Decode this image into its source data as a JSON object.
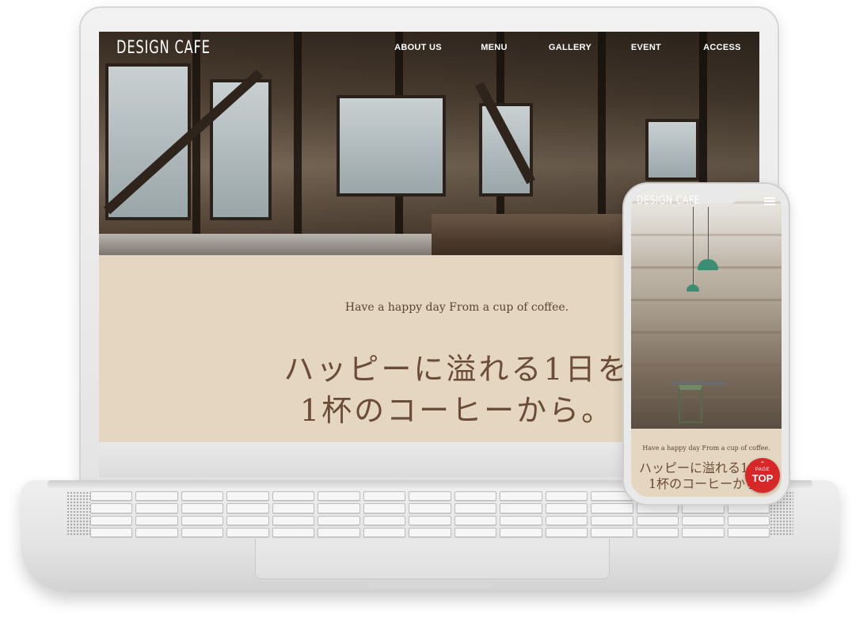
{
  "desktop": {
    "brand": "DESIGN CAFE",
    "nav": [
      "ABOUT US",
      "MENU",
      "GALLERY",
      "EVENT",
      "ACCESS"
    ],
    "tagline": "Have a happy day From a cup of coffee.",
    "catch_line1": "ハッピーに溢れる1日を",
    "catch_line2": "1杯のコーヒーから。"
  },
  "mobile": {
    "brand": "DESIGN CAFE",
    "tagline": "Have a happy day From a cup of coffee.",
    "catch_line1": "ハッピーに溢れる1日を",
    "catch_line2": "1杯のコーヒーから。",
    "pagetop_small": "PAGE",
    "pagetop_large": "TOP",
    "pagetop_color": "#d62828"
  },
  "colors": {
    "concept_bg": "#e4d6c0",
    "catch_text": "#6a4c38"
  }
}
